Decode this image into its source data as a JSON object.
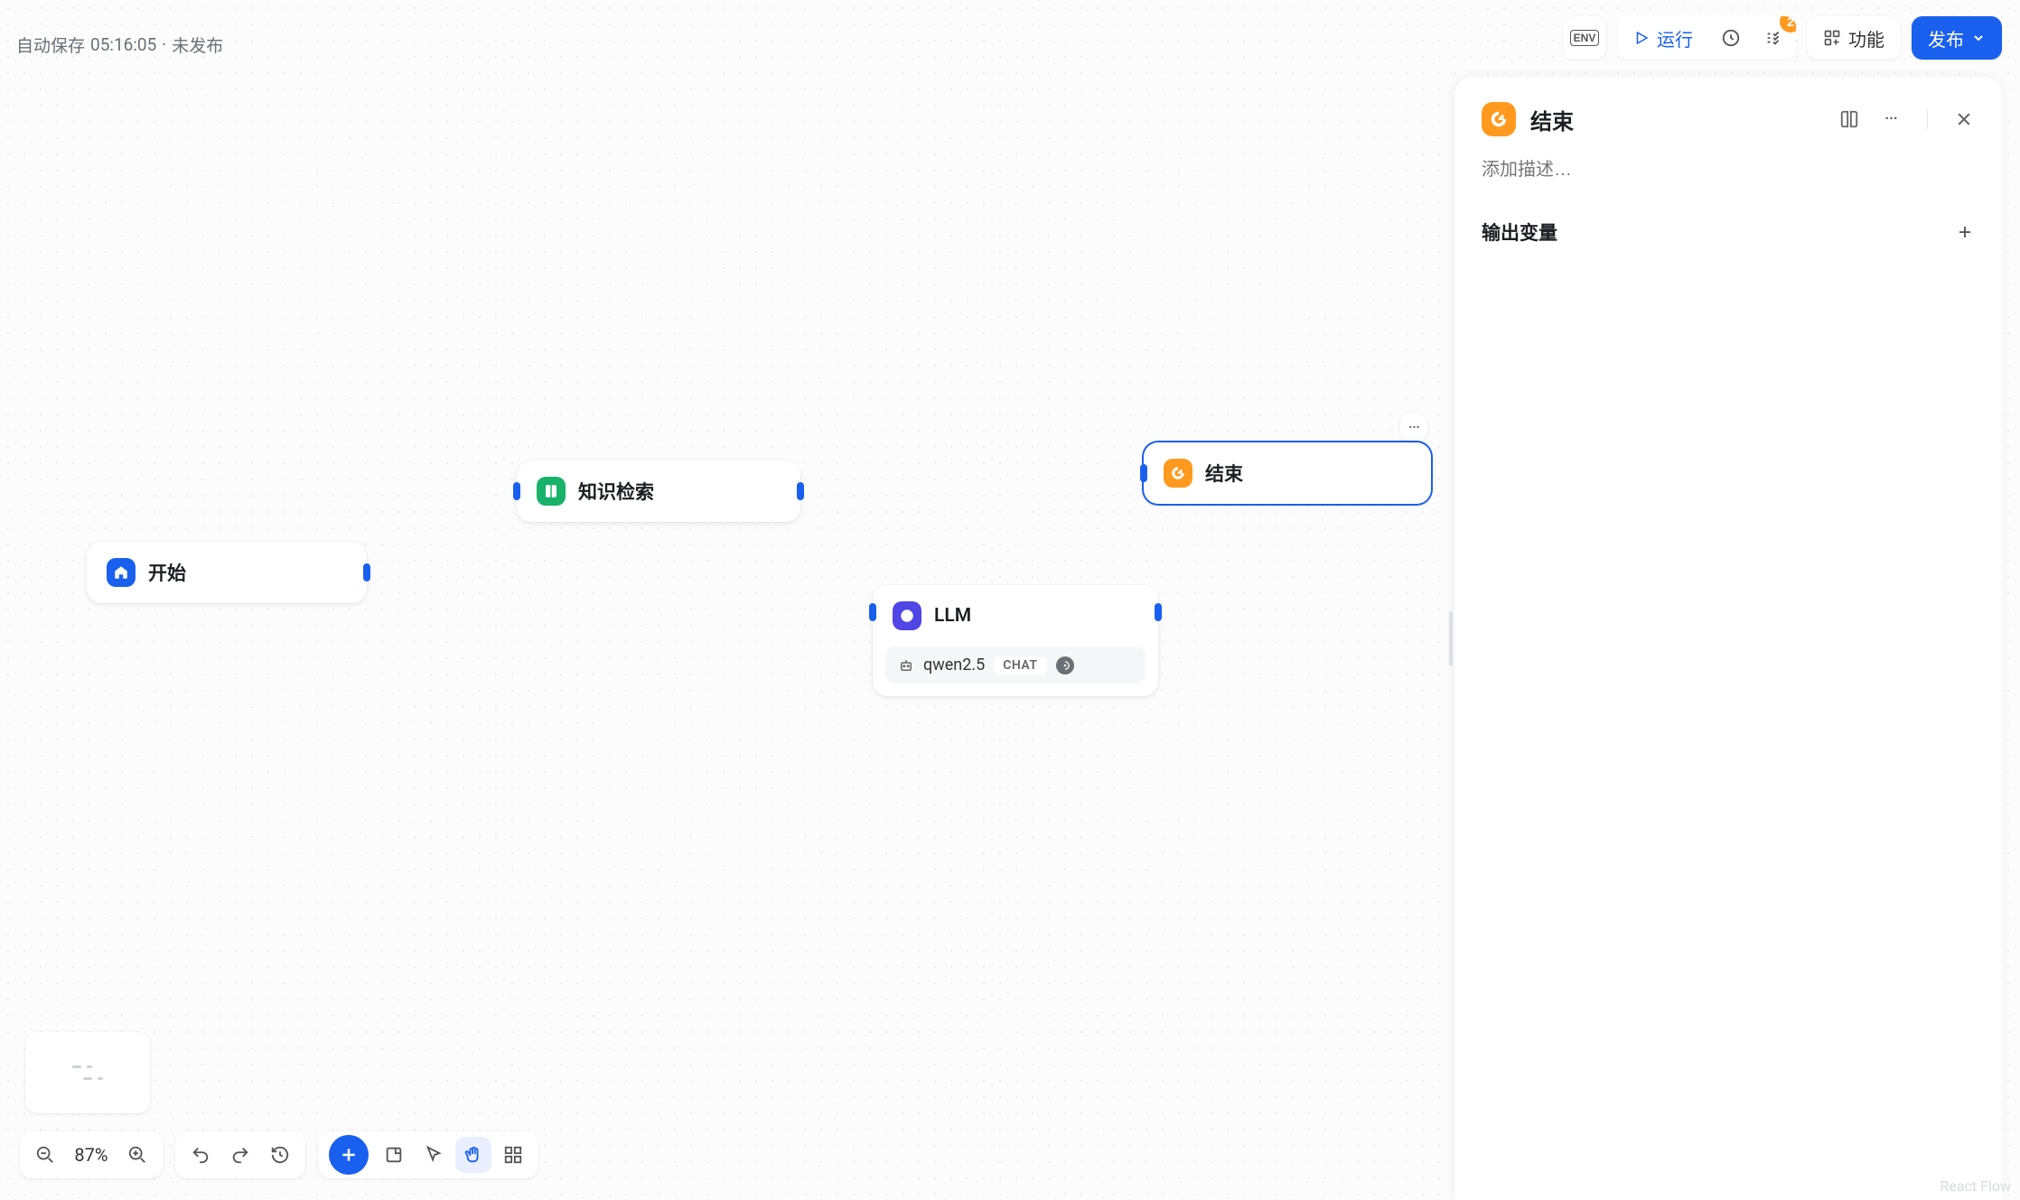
{
  "status": {
    "autosave": "自动保存",
    "time": "05:16:05",
    "state": "未发布"
  },
  "topbar": {
    "env": "ENV",
    "run": "运行",
    "badge": "2",
    "feature": "功能",
    "publish": "发布"
  },
  "nodes": {
    "start": {
      "title": "开始"
    },
    "knowledge": {
      "title": "知识检索"
    },
    "llm": {
      "title": "LLM",
      "model": "qwen2.5",
      "mode": "CHAT"
    },
    "end": {
      "title": "结束"
    }
  },
  "panel": {
    "title": "结束",
    "desc_placeholder": "添加描述…",
    "section": "输出变量"
  },
  "zoom": {
    "value": "87%"
  },
  "watermark": "React Flow"
}
